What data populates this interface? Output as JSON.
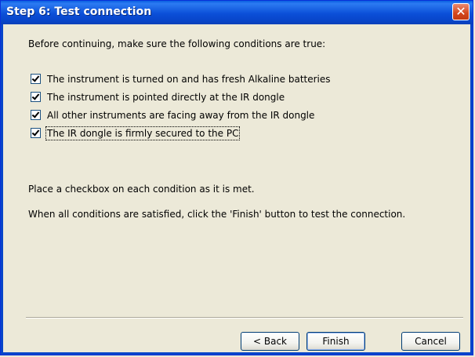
{
  "window": {
    "title": "Step 6: Test connection"
  },
  "intro": "Before continuing, make sure the following conditions are true:",
  "conditions": [
    {
      "label": "The instrument is turned on and has fresh Alkaline batteries",
      "checked": true
    },
    {
      "label": "The instrument is pointed directly at the IR dongle",
      "checked": true
    },
    {
      "label": "All other instruments are facing away from the IR dongle",
      "checked": true
    },
    {
      "label": "The IR dongle is firmly secured to the PC",
      "checked": true
    }
  ],
  "note_checkbox": "Place a checkbox on each condition as it is met.",
  "note_finish": "When all conditions are satisfied, click the 'Finish' button to test the connection.",
  "buttons": {
    "back": "< Back",
    "finish": "Finish",
    "cancel": "Cancel"
  },
  "icons": {
    "close": "close-icon",
    "check": "checkmark-icon"
  },
  "colors": {
    "titlebar": "#0845C9",
    "close": "#D4461C",
    "dialog_bg": "#ECE9D8"
  }
}
